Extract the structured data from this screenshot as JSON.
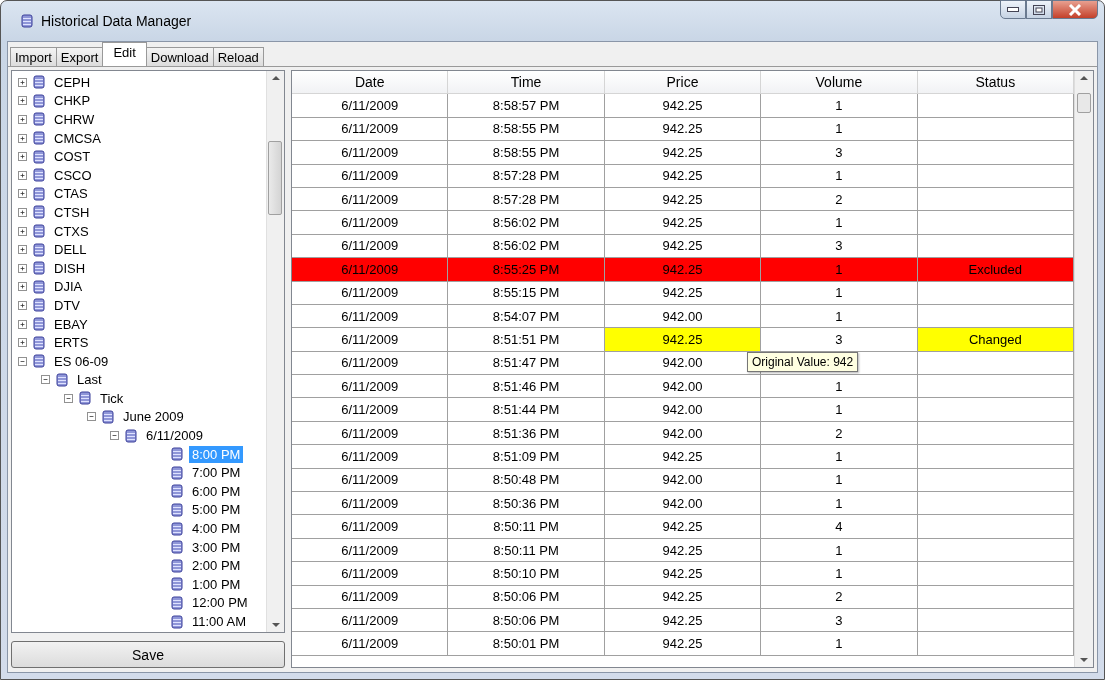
{
  "window": {
    "title": "Historical Data Manager"
  },
  "tabs": [
    {
      "label": "Import",
      "selected": false
    },
    {
      "label": "Export",
      "selected": false
    },
    {
      "label": "Edit",
      "selected": true
    },
    {
      "label": "Download",
      "selected": false
    },
    {
      "label": "Reload",
      "selected": false
    }
  ],
  "tree": [
    {
      "label": "CEPH",
      "expanded": false,
      "selected": false
    },
    {
      "label": "CHKP",
      "expanded": false,
      "selected": false
    },
    {
      "label": "CHRW",
      "expanded": false,
      "selected": false
    },
    {
      "label": "CMCSA",
      "expanded": false,
      "selected": false
    },
    {
      "label": "COST",
      "expanded": false,
      "selected": false
    },
    {
      "label": "CSCO",
      "expanded": false,
      "selected": false
    },
    {
      "label": "CTAS",
      "expanded": false,
      "selected": false
    },
    {
      "label": "CTSH",
      "expanded": false,
      "selected": false
    },
    {
      "label": "CTXS",
      "expanded": false,
      "selected": false
    },
    {
      "label": "DELL",
      "expanded": false,
      "selected": false
    },
    {
      "label": "DISH",
      "expanded": false,
      "selected": false
    },
    {
      "label": "DJIA",
      "expanded": false,
      "selected": false
    },
    {
      "label": "DTV",
      "expanded": false,
      "selected": false
    },
    {
      "label": "EBAY",
      "expanded": false,
      "selected": false
    },
    {
      "label": "ERTS",
      "expanded": false,
      "selected": false
    },
    {
      "label": "ES 06-09",
      "expanded": true,
      "selected": false,
      "children": [
        {
          "label": "Last",
          "expanded": true,
          "selected": false,
          "children": [
            {
              "label": "Tick",
              "expanded": true,
              "selected": false,
              "children": [
                {
                  "label": "June 2009",
                  "expanded": true,
                  "selected": false,
                  "children": [
                    {
                      "label": "6/11/2009",
                      "expanded": true,
                      "selected": false,
                      "children": [
                        {
                          "label": "8:00 PM",
                          "selected": true
                        },
                        {
                          "label": "7:00 PM",
                          "selected": false
                        },
                        {
                          "label": "6:00 PM",
                          "selected": false
                        },
                        {
                          "label": "5:00 PM",
                          "selected": false
                        },
                        {
                          "label": "4:00 PM",
                          "selected": false
                        },
                        {
                          "label": "3:00 PM",
                          "selected": false
                        },
                        {
                          "label": "2:00 PM",
                          "selected": false
                        },
                        {
                          "label": "1:00 PM",
                          "selected": false
                        },
                        {
                          "label": "12:00 PM",
                          "selected": false
                        },
                        {
                          "label": "11:00 AM",
                          "selected": false
                        }
                      ]
                    }
                  ]
                }
              ]
            }
          ]
        }
      ]
    }
  ],
  "save_button": "Save",
  "table": {
    "columns": [
      "Date",
      "Time",
      "Price",
      "Volume",
      "Status"
    ],
    "rows": [
      {
        "kind": "normal",
        "date": "6/11/2009",
        "time": "8:58:57 PM",
        "price": "942.25",
        "volume": "1"
      },
      {
        "kind": "normal",
        "date": "6/11/2009",
        "time": "8:58:55 PM",
        "price": "942.25",
        "volume": "1"
      },
      {
        "kind": "normal",
        "date": "6/11/2009",
        "time": "8:58:55 PM",
        "price": "942.25",
        "volume": "3"
      },
      {
        "kind": "normal",
        "date": "6/11/2009",
        "time": "8:57:28 PM",
        "price": "942.25",
        "volume": "1"
      },
      {
        "kind": "normal",
        "date": "6/11/2009",
        "time": "8:57:28 PM",
        "price": "942.25",
        "volume": "2"
      },
      {
        "kind": "normal",
        "date": "6/11/2009",
        "time": "8:56:02 PM",
        "price": "942.25",
        "volume": "1"
      },
      {
        "kind": "normal",
        "date": "6/11/2009",
        "time": "8:56:02 PM",
        "price": "942.25",
        "volume": "3"
      },
      {
        "kind": "excluded",
        "date": "6/11/2009",
        "time": "8:55:25 PM",
        "price": "942.25",
        "volume": "1",
        "status": "Excluded"
      },
      {
        "kind": "normal",
        "date": "6/11/2009",
        "time": "8:55:15 PM",
        "price": "942.25",
        "volume": "1"
      },
      {
        "kind": "normal",
        "date": "6/11/2009",
        "time": "8:54:07 PM",
        "price": "942.00",
        "volume": "1"
      },
      {
        "kind": "changed",
        "date": "6/11/2009",
        "time": "8:51:51 PM",
        "price": "942.25",
        "volume": "3",
        "status": "Changed",
        "tooltip": "Original Value: 942"
      },
      {
        "kind": "normal",
        "date": "6/11/2009",
        "time": "8:51:47 PM",
        "price": "942.00"
      },
      {
        "kind": "normal",
        "date": "6/11/2009",
        "time": "8:51:46 PM",
        "price": "942.00",
        "volume": "1"
      },
      {
        "kind": "normal",
        "date": "6/11/2009",
        "time": "8:51:44 PM",
        "price": "942.00",
        "volume": "1"
      },
      {
        "kind": "normal",
        "date": "6/11/2009",
        "time": "8:51:36 PM",
        "price": "942.00",
        "volume": "2"
      },
      {
        "kind": "normal",
        "date": "6/11/2009",
        "time": "8:51:09 PM",
        "price": "942.25",
        "volume": "1"
      },
      {
        "kind": "normal",
        "date": "6/11/2009",
        "time": "8:50:48 PM",
        "price": "942.00",
        "volume": "1"
      },
      {
        "kind": "normal",
        "date": "6/11/2009",
        "time": "8:50:36 PM",
        "price": "942.00",
        "volume": "1"
      },
      {
        "kind": "normal",
        "date": "6/11/2009",
        "time": "8:50:11 PM",
        "price": "942.25",
        "volume": "4"
      },
      {
        "kind": "normal",
        "date": "6/11/2009",
        "time": "8:50:11 PM",
        "price": "942.25",
        "volume": "1"
      },
      {
        "kind": "normal",
        "date": "6/11/2009",
        "time": "8:50:10 PM",
        "price": "942.25",
        "volume": "1"
      },
      {
        "kind": "normal",
        "date": "6/11/2009",
        "time": "8:50:06 PM",
        "price": "942.25",
        "volume": "2"
      },
      {
        "kind": "normal",
        "date": "6/11/2009",
        "time": "8:50:06 PM",
        "price": "942.25",
        "volume": "3"
      },
      {
        "kind": "normal",
        "date": "6/11/2009",
        "time": "8:50:01 PM",
        "price": "942.25",
        "volume": "1"
      }
    ]
  }
}
